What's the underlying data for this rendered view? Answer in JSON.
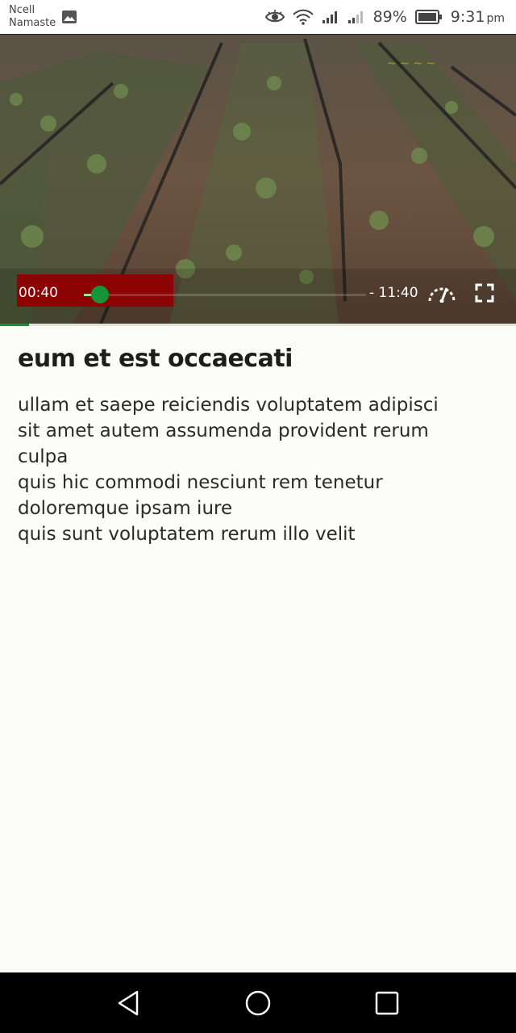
{
  "status_bar": {
    "carrier_line1": "Ncell",
    "carrier_line2": "Namaste",
    "battery_percent": "89%",
    "time": "9:31",
    "ampm": "pm",
    "icons": [
      "gallery-icon",
      "eye-icon",
      "wifi-icon",
      "signal-icon",
      "signal-icon",
      "battery-icon"
    ]
  },
  "video": {
    "current_time": "00:40",
    "remaining_time": "- 11:40",
    "played_fraction": 0.057,
    "buffered_fraction": 0.08,
    "accent_color": "#159438",
    "time_badge_color": "#8b0303"
  },
  "content": {
    "title": "eum et est occaecati",
    "description_lines": [
      "ullam et saepe reiciendis voluptatem adipisci",
      "sit amet autem assumenda provident rerum",
      "culpa",
      "quis hic commodi nesciunt rem tenetur",
      "doloremque ipsam iure",
      "quis sunt voluptatem rerum illo velit"
    ]
  },
  "nav_bar": {
    "buttons": [
      "back-icon",
      "home-icon",
      "recents-icon"
    ]
  }
}
